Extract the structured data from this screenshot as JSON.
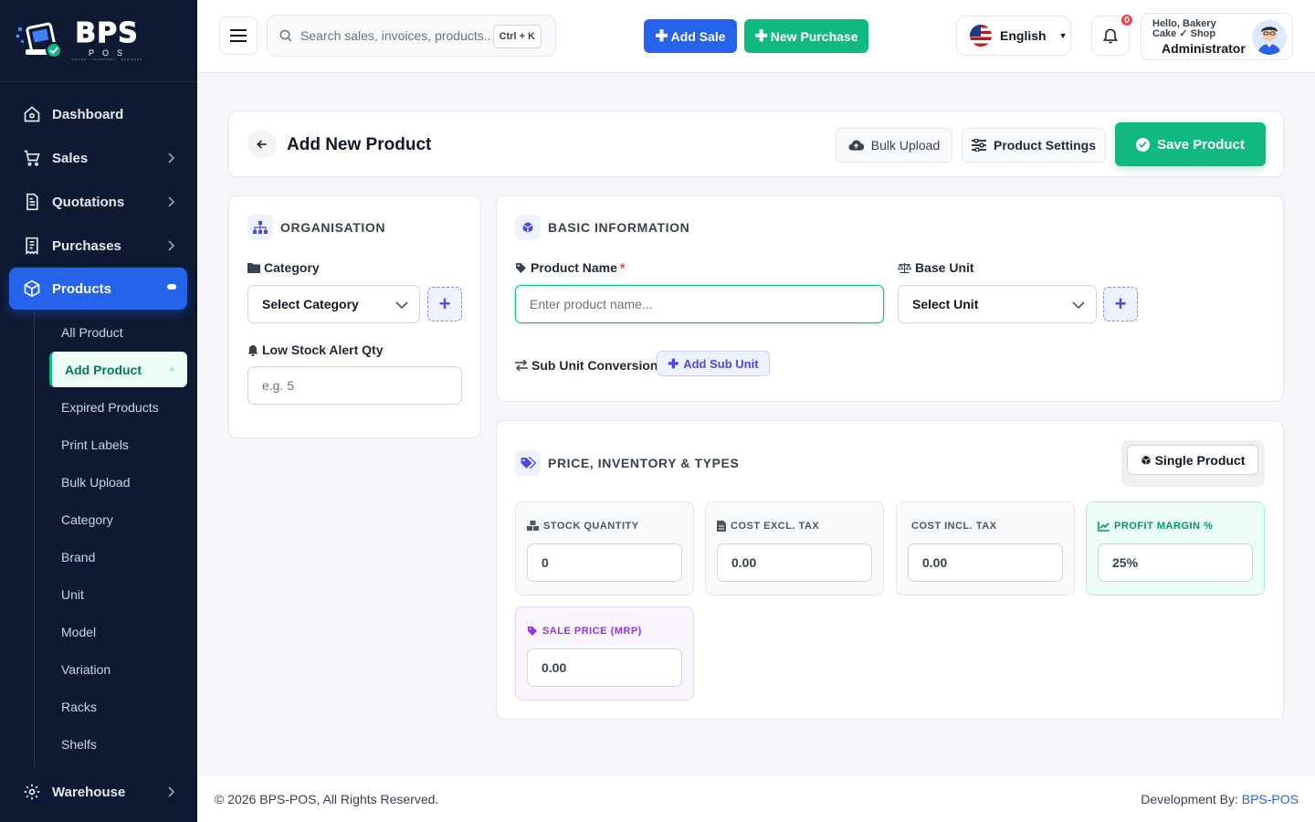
{
  "brand": {
    "name": "BPS",
    "sub": "POS",
    "tagline": "ONLINE · INVENTORY · BUSINESS"
  },
  "sidebar": {
    "items": [
      {
        "label": "Dashboard"
      },
      {
        "label": "Sales"
      },
      {
        "label": "Quotations"
      },
      {
        "label": "Purchases"
      },
      {
        "label": "Products"
      }
    ],
    "products_sub": [
      "All Product",
      "Add Product",
      "Expired Products",
      "Print Labels",
      "Bulk Upload",
      "Category",
      "Brand",
      "Unit",
      "Model",
      "Variation",
      "Racks",
      "Shelfs"
    ],
    "warehouse": "Warehouse"
  },
  "topbar": {
    "search_placeholder": "Search sales, invoices, products...",
    "shortcut": "Ctrl + K",
    "add_sale": "Add Sale",
    "new_purchase": "New Purchase",
    "language": "English",
    "notifications": "0",
    "greeting": "Hello, Bakery Cake ✓ Shop",
    "role": "Administrator"
  },
  "page": {
    "title": "Add New Product",
    "bulk_upload": "Bulk Upload",
    "product_settings": "Product Settings",
    "save": "Save Product"
  },
  "organisation": {
    "title": "ORGANISATION",
    "category_label": "Category",
    "category_value": "Select Category",
    "low_stock_label": "Low Stock Alert Qty",
    "low_stock_placeholder": "e.g. 5"
  },
  "basic": {
    "title": "BASIC INFORMATION",
    "name_label": "Product Name",
    "required": "*",
    "name_placeholder": "Enter product name...",
    "unit_label": "Base Unit",
    "unit_value": "Select Unit",
    "sub_unit_label": "Sub Unit Conversions",
    "add_sub_unit": "Add Sub Unit"
  },
  "pricing": {
    "title": "PRICE, INVENTORY & TYPES",
    "type": "Single Product",
    "stock_label": "STOCK QUANTITY",
    "stock_value": "0",
    "cost_excl_label": "COST EXCL. TAX",
    "cost_excl_value": "0.00",
    "cost_incl_label": "COST INCL. TAX",
    "cost_incl_value": "0.00",
    "margin_label": "PROFIT MARGIN %",
    "margin_value": "25%",
    "sale_label": "SALE PRICE (MRP)",
    "sale_value": "0.00"
  },
  "footer": {
    "copyright": "© 2026 BPS-POS, All Rights Reserved.",
    "dev_prefix": "Development By: ",
    "dev_name": "BPS-POS"
  },
  "colors": {
    "primary": "#2563eb",
    "success": "#10b981",
    "sidebar": "#0e1a33",
    "accent": "#4f46e5"
  }
}
